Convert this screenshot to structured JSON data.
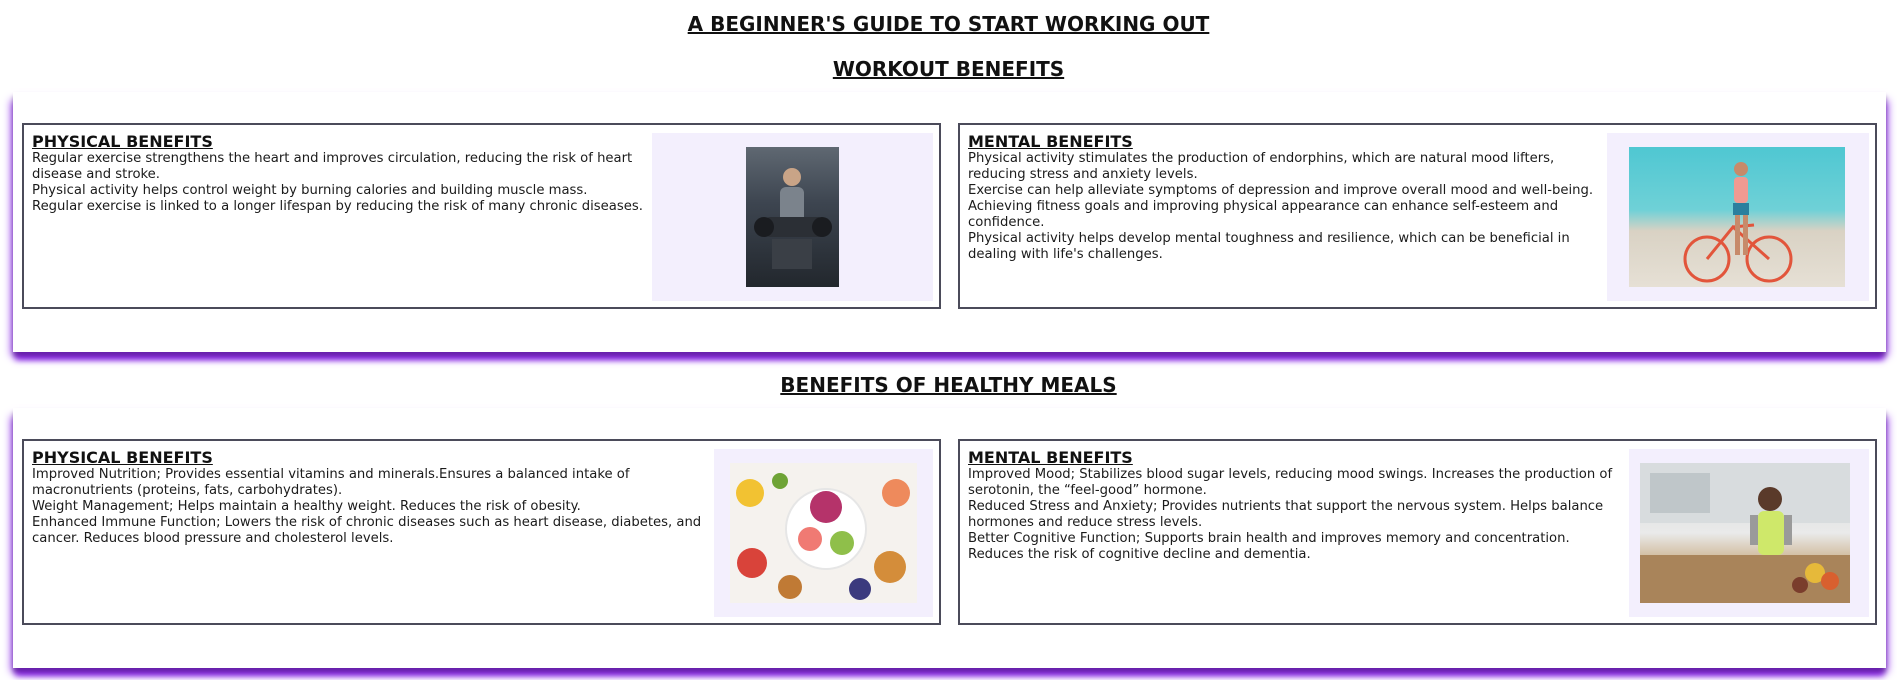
{
  "page": {
    "main_title": "A BEGINNER'S GUIDE TO START WORKING OUT",
    "accent_color": "#8a2be2"
  },
  "workout": {
    "title": "WORKOUT BENEFITS",
    "physical": {
      "heading": "PHYSICAL BENEFITS",
      "lines": [
        "Regular exercise strengthens the heart and improves circulation, reducing the risk of heart",
        "disease and stroke.",
        "Physical activity helps control weight by burning calories and building muscle mass.",
        "Regular exercise is linked to a longer lifespan by reducing the risk of many chronic diseases."
      ],
      "image": "man-exercising-photo"
    },
    "mental": {
      "heading": "MENTAL BENEFITS",
      "lines": [
        "Physical activity stimulates the production of endorphins, which are natural mood lifters,",
        "reducing stress and anxiety levels.",
        "Exercise can help alleviate symptoms of depression and improve overall mood and well-being.",
        "Achieving fitness goals and improving physical appearance can enhance self-esteem and",
        "confidence.",
        "Physical activity helps develop mental toughness and resilience, which can be beneficial in",
        "dealing with life's challenges."
      ],
      "image": "woman-with-bicycle-photo"
    }
  },
  "meals": {
    "title": "BENEFITS OF HEALTHY MEALS",
    "physical": {
      "heading": "PHYSICAL BENEFITS",
      "lines": [
        "Improved Nutrition; Provides essential vitamins and minerals.Ensures a balanced intake of",
        "macronutrients (proteins, fats, carbohydrates).",
        "Weight Management; Helps maintain a healthy weight. Reduces the risk of obesity.",
        "Enhanced Immune Function; Lowers the risk of chronic diseases such as heart disease, diabetes, and",
        "cancer. Reduces blood pressure and cholesterol levels."
      ],
      "image": "fruit-bowl-photo"
    },
    "mental": {
      "heading": "MENTAL BENEFITS",
      "lines": [
        "Improved Mood; Stabilizes blood sugar levels, reducing mood swings. Increases the production of",
        "serotonin, the “feel-good” hormone.",
        "Reduced Stress and Anxiety; Provides nutrients that support the nervous system. Helps balance",
        "hormones and reduce stress levels.",
        "Better Cognitive Function; Supports brain health and improves memory and concentration.",
        "Reduces the risk of cognitive decline and dementia."
      ],
      "image": "woman-in-kitchen-photo"
    }
  }
}
